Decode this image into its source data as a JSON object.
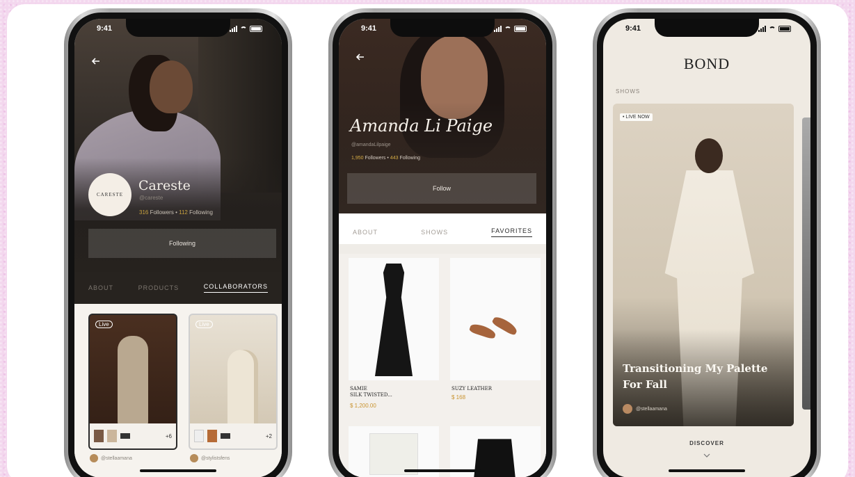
{
  "status_bar": {
    "time": "9:41"
  },
  "phone1": {
    "brand_logo": "CARESTE",
    "name": "Careste",
    "handle": "@careste",
    "followers_count": "316",
    "followers_label": "Followers",
    "following_count": "112",
    "following_label": "Following",
    "separator": "•",
    "follow_button": "Following",
    "tabs": [
      "ABOUT",
      "PRODUCTS",
      "COLLABORATORS"
    ],
    "tiles": [
      {
        "badge": "Live",
        "more": "+6",
        "creator": "@stellaamana"
      },
      {
        "badge": "Live",
        "more": "+2",
        "creator": "@stylistsfens"
      }
    ]
  },
  "phone2": {
    "name": "Amanda Li Paige",
    "handle": "@amandaLilpaige",
    "followers_count": "1,950",
    "followers_label": "Followers",
    "following_count": "443",
    "following_label": "Following",
    "separator": "•",
    "follow_button": "Follow",
    "tabs": [
      "ABOUT",
      "SHOWS",
      "FAVORITES"
    ],
    "products": [
      {
        "name_line1": "SAMIE",
        "name_line2": "SILK TWISTED...",
        "price": "$ 1,200.00"
      },
      {
        "name_line1": "SUZY LEATHER",
        "name_line2": "",
        "price": "$ 168"
      }
    ]
  },
  "phone3": {
    "brand": "BOND",
    "section": "SHOWS",
    "live_badge": "• LIVE NOW",
    "show_title": "Transitioning My Palette For Fall",
    "creator": "@stellaamana",
    "discover": "DISCOVER"
  },
  "colors": {
    "accent_gold": "#c9a23e",
    "dark_bg": "#27231f",
    "cream_bg": "#efeae2",
    "page_bg": "#f3d7ee"
  },
  "icons": {
    "back": "back-arrow-icon",
    "signal": "signal-icon",
    "wifi": "wifi-icon",
    "battery": "battery-icon",
    "chevron": "chevron-down-icon"
  }
}
